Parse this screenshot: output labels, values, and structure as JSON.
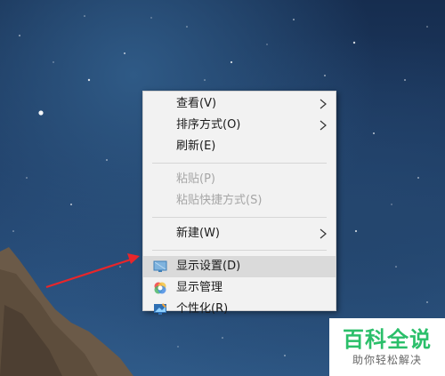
{
  "context_menu": {
    "items": [
      {
        "label": "查看(V)",
        "has_submenu": true
      },
      {
        "label": "排序方式(O)",
        "has_submenu": true
      },
      {
        "label": "刷新(E)"
      },
      {
        "label": "粘贴(P)",
        "disabled": true
      },
      {
        "label": "粘贴快捷方式(S)",
        "disabled": true
      },
      {
        "label": "新建(W)",
        "has_submenu": true
      },
      {
        "label": "显示设置(D)",
        "icon": "display-settings-icon",
        "highlighted": true
      },
      {
        "label": "显示管理",
        "icon": "display-manager-icon"
      },
      {
        "label": "个性化(R)",
        "icon": "personalize-icon"
      }
    ]
  },
  "watermark": {
    "title": "百科全说",
    "subtitle": "助你轻松解决"
  },
  "colors": {
    "menu_bg": "#f2f2f2",
    "highlight": "#dadada",
    "arrow": "#e8262a",
    "watermark_green": "#2bbf6a"
  }
}
